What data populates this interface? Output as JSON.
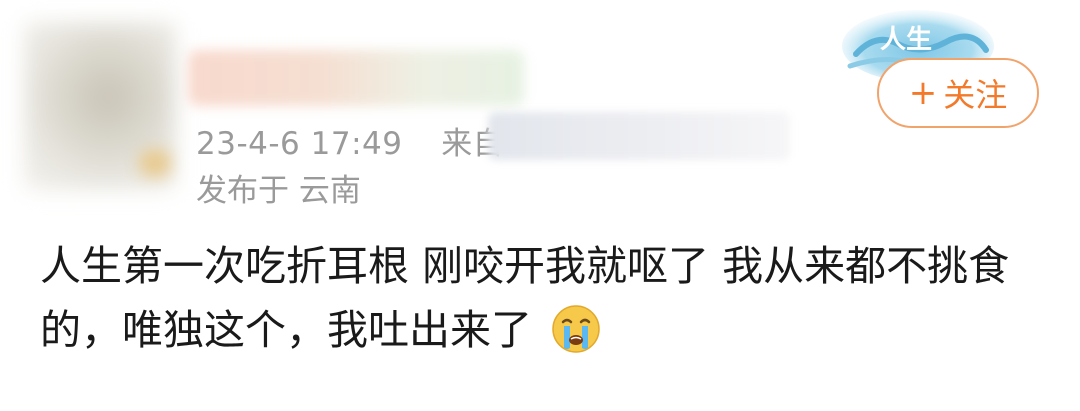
{
  "post": {
    "timestamp": "23-4-6 17:49",
    "source_prefix": "来自",
    "location": "发布于 云南",
    "follow_button": {
      "plus": "+",
      "label": "关注"
    },
    "badge_text": "人生"
  },
  "content": {
    "text": "人生第一次吃折耳根 刚咬开我就呕了 我从来都不挑食的，唯独这个，我吐出来了",
    "emoji": "crying-face-icon"
  },
  "colors": {
    "accent": "#f27a2a",
    "meta_text": "#9a9a9a",
    "body_text": "#1a1a1a"
  }
}
